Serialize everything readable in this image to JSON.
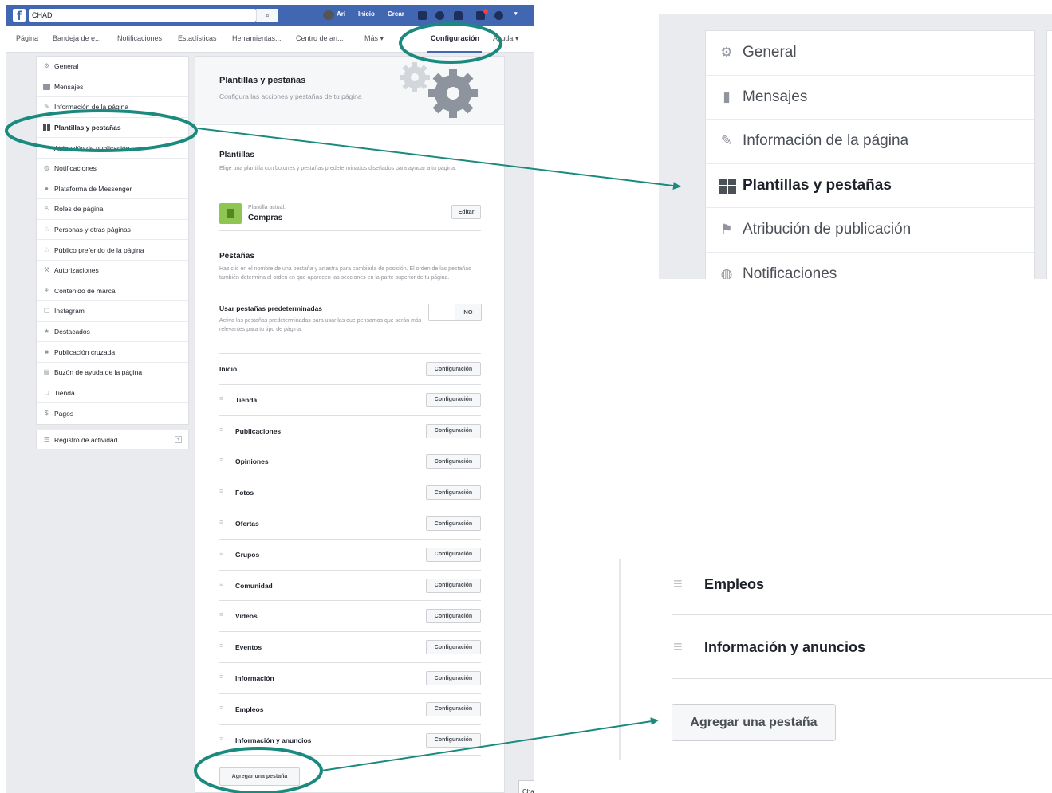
{
  "header": {
    "search_value": "CHAD",
    "user_name": "Ari",
    "home": "Inicio",
    "create": "Crear"
  },
  "page_nav": [
    "Página",
    "Bandeja de e...",
    "Notificaciones",
    "Estadísticas",
    "Herramientas...",
    "Centro de an...",
    "Más ▾",
    "Configuración",
    "Ayuda ▾"
  ],
  "sidebar": {
    "items": [
      {
        "label": "General",
        "icon": "gear-icon"
      },
      {
        "label": "Mensajes",
        "icon": "chat-bubbles-icon"
      },
      {
        "label": "Información de la página",
        "icon": "pencil-icon"
      },
      {
        "label": "Plantillas y pestañas",
        "icon": "grid-icon"
      },
      {
        "label": "Atribución de publicación",
        "icon": "flag-icon"
      },
      {
        "label": "Notificaciones",
        "icon": "globe-icon"
      },
      {
        "label": "Plataforma de Messenger",
        "icon": "messenger-icon"
      },
      {
        "label": "Roles de página",
        "icon": "person-icon"
      },
      {
        "label": "Personas y otras páginas",
        "icon": "people-icon"
      },
      {
        "label": "Público preferido de la página",
        "icon": "people-icon"
      },
      {
        "label": "Autorizaciones",
        "icon": "wrench-icon"
      },
      {
        "label": "Contenido de marca",
        "icon": "handshake-icon"
      },
      {
        "label": "Instagram",
        "icon": "instagram-icon"
      },
      {
        "label": "Destacados",
        "icon": "star-icon"
      },
      {
        "label": "Publicación cruzada",
        "icon": "video-icon"
      },
      {
        "label": "Buzón de ayuda de la página",
        "icon": "inbox-icon"
      },
      {
        "label": "Tienda",
        "icon": "shop-icon"
      },
      {
        "label": "Pagos",
        "icon": "dollar-icon"
      }
    ],
    "activity_log": "Registro de actividad"
  },
  "panel": {
    "title": "Plantillas y pestañas",
    "subtitle": "Configura las acciones y pestañas de tu página",
    "templates_heading": "Plantillas",
    "templates_desc": "Elige una plantilla con botones y pestañas predeterminados diseñados para ayudar a tu página.",
    "current_template_label": "Plantilla actual:",
    "current_template": "Compras",
    "edit": "Editar",
    "tabs_heading": "Pestañas",
    "tabs_desc": "Haz clic en el nombre de una pestaña y arrastra para cambiarla de posición. El orden de las pestañas también determina el orden en que aparecen las secciones en la parte superior de tu página.",
    "default_tabs_label": "Usar pestañas predeterminadas",
    "default_tabs_desc": "Activa las pestañas predeterminadas para usar las que pensamos que serán más relevantes para tu tipo de página.",
    "toggle_value": "NO",
    "config_button": "Configuración",
    "tabs": [
      "Inicio",
      "Tienda",
      "Publicaciones",
      "Opiniones",
      "Fotos",
      "Ofertas",
      "Grupos",
      "Comunidad",
      "Videos",
      "Eventos",
      "Información",
      "Empleos",
      "Información y anuncios"
    ],
    "add_tab": "Agregar una pestaña"
  },
  "chat_label": "Cha",
  "zoom_sidebar": [
    {
      "label": "General",
      "icon": "gear-icon"
    },
    {
      "label": "Mensajes",
      "icon": "chat-bubbles-icon"
    },
    {
      "label": "Información de la página",
      "icon": "pencil-icon"
    },
    {
      "label": "Plantillas y pestañas",
      "icon": "grid-icon"
    },
    {
      "label": "Atribución de publicación",
      "icon": "flag-icon"
    },
    {
      "label": "Notificaciones",
      "icon": "globe-icon"
    }
  ],
  "zoom_tabs": [
    "Empleos",
    "Información y anuncios"
  ],
  "zoom_add_tab": "Agregar una pestaña",
  "colors": {
    "accent": "#4267b2",
    "annotation": "#1a8a7e",
    "background": "#e9ebee"
  }
}
